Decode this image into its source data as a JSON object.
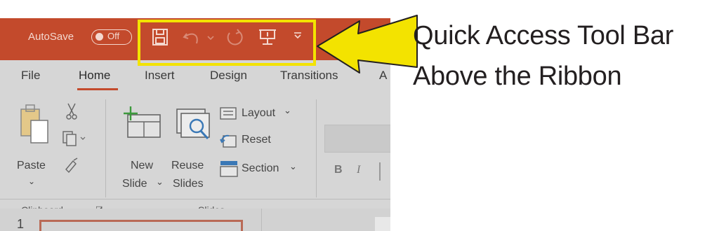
{
  "titlebar": {
    "autosave_label": "AutoSave",
    "autosave_state": "Off",
    "accent_color": "#c34a2c"
  },
  "qat": {
    "items": [
      {
        "name": "save-icon"
      },
      {
        "name": "undo-icon"
      },
      {
        "name": "undo-dropdown-icon"
      },
      {
        "name": "redo-icon"
      },
      {
        "name": "present-icon"
      },
      {
        "name": "customize-dropdown-icon"
      }
    ],
    "highlight_color": "#f3e300"
  },
  "tabs": [
    "File",
    "Home",
    "Insert",
    "Design",
    "Transitions",
    "A"
  ],
  "active_tab": "Home",
  "ribbon": {
    "clipboard": {
      "paste_label": "Paste",
      "group_label": "Clipboard"
    },
    "slides": {
      "new_label_1": "New",
      "new_label_2": "Slide",
      "reuse_label_1": "Reuse",
      "reuse_label_2": "Slides",
      "layout_label": "Layout",
      "reset_label": "Reset",
      "section_label": "Section",
      "group_label": "Slides"
    },
    "font": {
      "bold": "B",
      "italic": "I"
    }
  },
  "slide_panel": {
    "slide_number": "1"
  },
  "annotation": {
    "line1": "Quick Access Tool Bar",
    "line2": "Above the Ribbon",
    "arrow_color": "#f3e300"
  }
}
